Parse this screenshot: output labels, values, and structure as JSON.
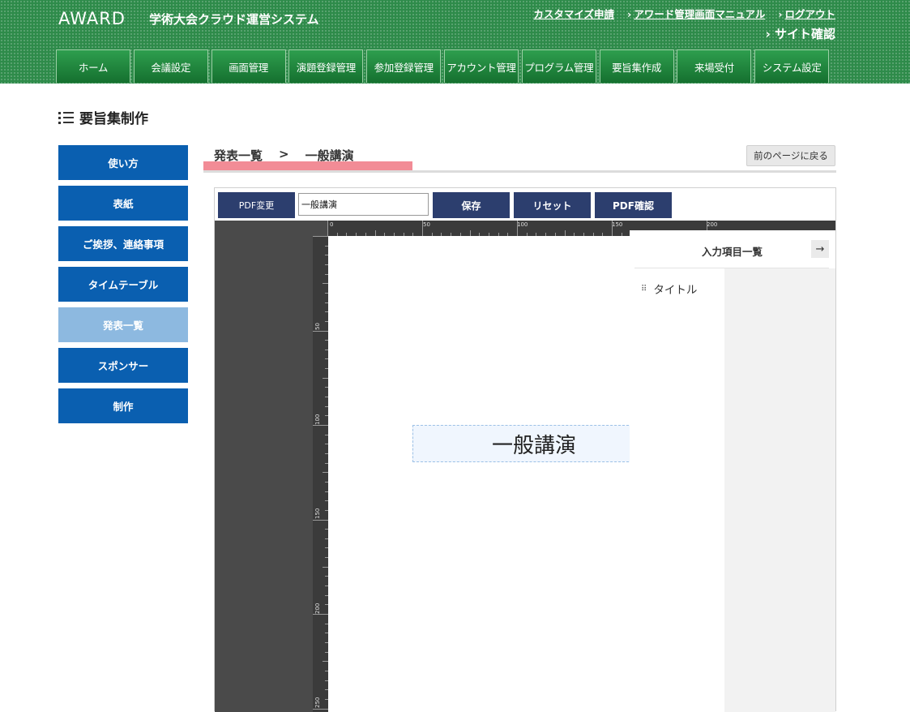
{
  "header": {
    "logo": "AWARD",
    "system_title": "学術大会クラウド運営システム",
    "top_links": [
      "カスタマイズ申請",
      "アワード管理画面マニュアル",
      "ログアウト"
    ],
    "site_check": "サイト確認",
    "nav": [
      "ホーム",
      "会議設定",
      "画面管理",
      "演題登録管理",
      "参加登録管理",
      "アカウント管理",
      "プログラム管理",
      "要旨集作成",
      "来場受付",
      "システム設定"
    ]
  },
  "page_title": "要旨集制作",
  "sidebar": {
    "items": [
      {
        "label": "使い方"
      },
      {
        "label": "表紙"
      },
      {
        "label": "ご挨拶、連絡事項"
      },
      {
        "label": "タイムテーブル"
      },
      {
        "label": "発表一覧"
      },
      {
        "label": "スポンサー"
      },
      {
        "label": "制作"
      }
    ],
    "active": "発表一覧"
  },
  "breadcrumb": {
    "parent": "発表一覧",
    "separator": ">",
    "current": "一般講演"
  },
  "back_button": "前のページに戻る",
  "toolbar": {
    "pdf_change": "PDF変更",
    "name_value": "一般講演",
    "save": "保存",
    "reset": "リセット",
    "pdf_confirm": "PDF確認"
  },
  "ruler": {
    "h_labels": [
      "0",
      "50",
      "100",
      "150",
      "200"
    ],
    "v_labels": [
      "50",
      "100",
      "150",
      "200",
      "250"
    ]
  },
  "canvas": {
    "title_text": "一般講演"
  },
  "panel": {
    "title": "入力項目一覧",
    "arrow": "→",
    "items": [
      "タイトル"
    ]
  },
  "colors": {
    "header_green": "#2e8b4a",
    "sidebar_blue": "#0a5fb0",
    "sidebar_active": "#8db9e0",
    "toolbar_navy": "#2c3e6e",
    "breadcrumb_highlight": "#f28c96"
  }
}
